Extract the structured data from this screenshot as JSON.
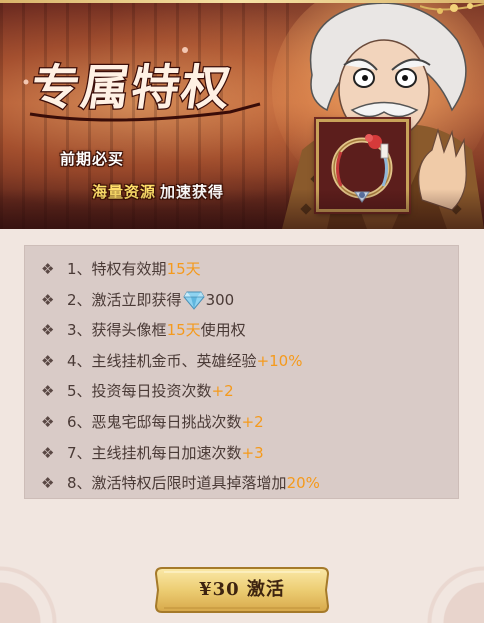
{
  "banner": {
    "title": "专属特权",
    "subtitle_line1": "前期必买",
    "subtitle_line2_highlight": "海量资源",
    "subtitle_line2_rest": "加速获得"
  },
  "perks": [
    {
      "num": "1、",
      "text": "特权有效期",
      "highlight": "15天",
      "suffix": ""
    },
    {
      "num": "2、",
      "text": "激活立即获得",
      "icon": "diamond-gem-icon",
      "value": "300"
    },
    {
      "num": "3、",
      "text": "获得头像框",
      "highlight": "15天",
      "suffix": "使用权"
    },
    {
      "num": "4、",
      "text": "主线挂机金币、英雄经验",
      "highlight": "+10%",
      "suffix": ""
    },
    {
      "num": "5、",
      "text": "投资每日投资次数",
      "highlight": "+2",
      "suffix": ""
    },
    {
      "num": "6、",
      "text": "恶鬼宅邸每日挑战次数",
      "highlight": "+2",
      "suffix": ""
    },
    {
      "num": "7、",
      "text": "主线挂机每日加速次数",
      "highlight": "+3",
      "suffix": ""
    },
    {
      "num": "8、",
      "text": "激活特权后限时道具掉落增加",
      "highlight": "20%",
      "suffix": ""
    }
  ],
  "bullet_glyph": "❖",
  "buy_button": {
    "label": "¥30 激活"
  },
  "colors": {
    "highlight": "#f59a1c",
    "perk_text": "#4a3a36",
    "list_bg": "#d9cbc7",
    "panel_bg": "#f1e6e0",
    "gold": "#e9c66d"
  }
}
